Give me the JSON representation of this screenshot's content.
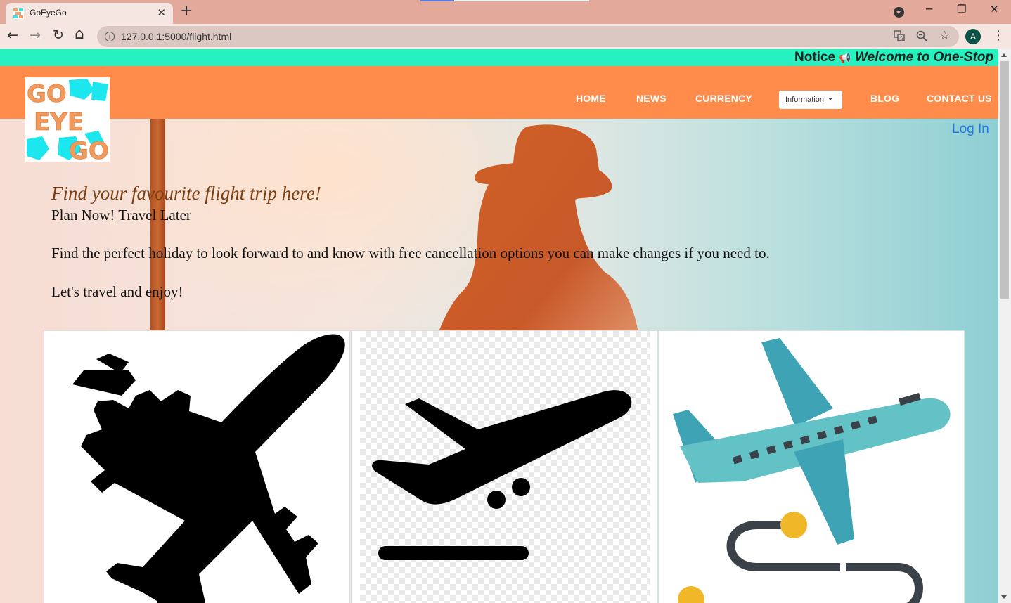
{
  "browser": {
    "tab_title": "GoEyeGo",
    "tab_close": "✕",
    "new_tab": "+",
    "url": "127.0.0.1:5000/flight.html",
    "avatar_letter": "A",
    "window_controls": {
      "minimize": "─",
      "restore": "❐",
      "close": "✕"
    },
    "nav": {
      "back": "←",
      "forward": "→",
      "reload": "↻",
      "home": "⌂"
    }
  },
  "notice": {
    "label": "Notice",
    "icon": "megaphone-icon",
    "message": "Welcome to One-Stop T"
  },
  "logo": {
    "lines": [
      "GO",
      "EYE",
      "GO"
    ]
  },
  "navbar": {
    "links": [
      "HOME",
      "NEWS",
      "CURRENCY",
      "BLOG",
      "CONTACT US"
    ],
    "information_dropdown": "Information",
    "login": "Log In"
  },
  "hero": {
    "heading": "Find your favourite flight trip here!",
    "subheading": "Plan Now! Travel Later",
    "paragraph_1": "Find the perfect holiday to look forward to and know with free cancellation options you can make changes if you need to.",
    "paragraph_2": "Let's travel and enjoy!"
  },
  "cards": [
    {
      "icon": "airplane-silhouette-icon"
    },
    {
      "icon": "airplane-takeoff-icon"
    },
    {
      "icon": "airplane-route-icon"
    }
  ],
  "colors": {
    "tab_bar": "#e3aa9c",
    "notice_bar": "#26f2bf",
    "navbar": "#ff8c4a",
    "login_link": "#1f7be8",
    "heading": "#7b3e12",
    "plane_teal": "#62c2c6",
    "plane_dark_teal": "#3ea3b4",
    "route_dot": "#f0b829",
    "route_line": "#3b4148"
  }
}
